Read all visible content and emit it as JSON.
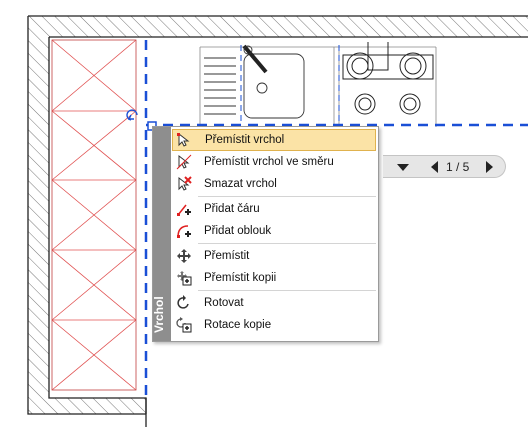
{
  "menu": {
    "title": "Vrchol",
    "items": [
      {
        "label": "Přemístit vrchol",
        "icon": "move-vertex-icon",
        "highlighted": true
      },
      {
        "label": "Přemístit vrchol ve směru",
        "icon": "move-vertex-direction-icon"
      },
      {
        "label": "Smazat vrchol",
        "icon": "delete-vertex-icon"
      },
      {
        "label": "Přidat čáru",
        "icon": "add-line-icon"
      },
      {
        "label": "Přidat oblouk",
        "icon": "add-arc-icon"
      },
      {
        "label": "Přemístit",
        "icon": "move-icon"
      },
      {
        "label": "Přemístit kopii",
        "icon": "move-copy-icon"
      },
      {
        "label": "Rotovat",
        "icon": "rotate-icon"
      },
      {
        "label": "Rotace kopie",
        "icon": "rotate-copy-icon"
      }
    ]
  },
  "pager": {
    "text": "1 / 5"
  },
  "colors": {
    "selection": "#1a4fd6",
    "pantry": "#e05050",
    "wall": "#222222",
    "highlight": "#fbe3a6"
  }
}
